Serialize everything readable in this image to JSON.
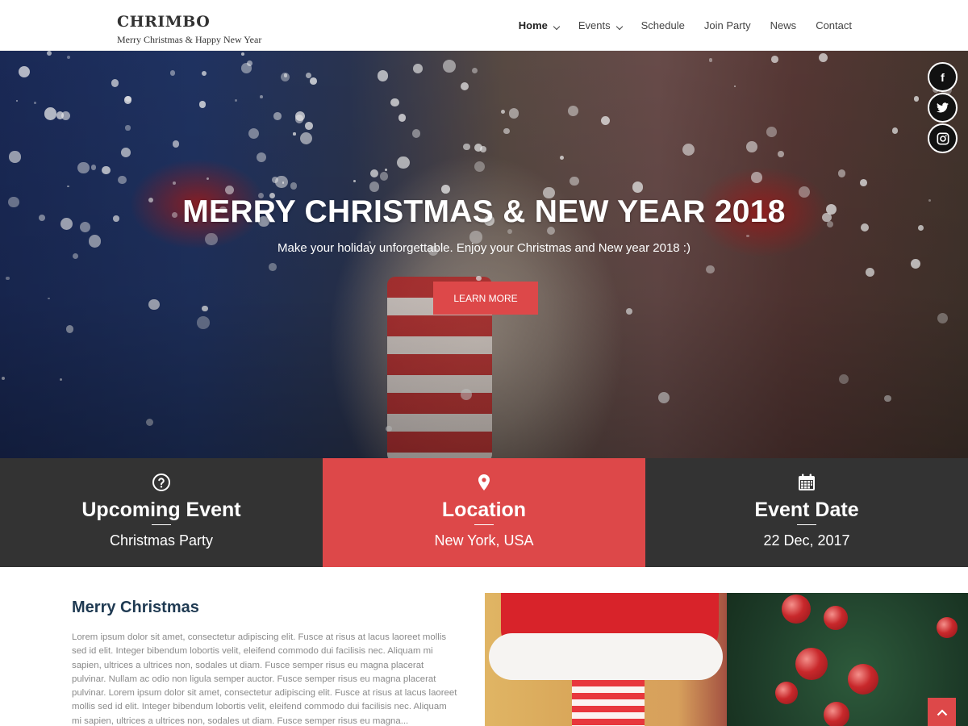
{
  "brand": {
    "title": "CHRIMBO",
    "tagline": "Merry Christmas & Happy New Year"
  },
  "nav": {
    "items": [
      {
        "label": "Home",
        "dropdown": true,
        "active": true
      },
      {
        "label": "Events",
        "dropdown": true
      },
      {
        "label": "Schedule"
      },
      {
        "label": "Join Party"
      },
      {
        "label": "News"
      },
      {
        "label": "Contact"
      }
    ]
  },
  "hero": {
    "title": "MERRY CHRISTMAS & NEW YEAR 2018",
    "subtitle": "Make your holiday unforgettable. Enjoy your Christmas and New year 2018 :)",
    "button_label": "LEARN MORE"
  },
  "social": {
    "facebook_glyph": "f",
    "twitter_glyph": "t"
  },
  "info": [
    {
      "icon": "question-circle-icon",
      "title": "Upcoming Event",
      "value": "Christmas Party"
    },
    {
      "icon": "map-marker-icon",
      "title": "Location",
      "value": "New York, USA"
    },
    {
      "icon": "calendar-icon",
      "title": "Event Date",
      "value": "22 Dec, 2017"
    }
  ],
  "article": {
    "title": "Merry Christmas",
    "body": "Lorem ipsum dolor sit amet, consectetur adipiscing elit. Fusce at risus at lacus laoreet mollis sed id elit. Integer bibendum lobortis velit, eleifend commodo dui facilisis nec. Aliquam mi sapien, ultrices a ultrices non, sodales ut diam. Fusce semper risus eu magna placerat pulvinar. Nullam ac odio non ligula semper auctor. Fusce semper risus eu magna placerat pulvinar. Lorem ipsum dolor sit amet, consectetur adipiscing elit. Fusce at risus at lacus laoreet mollis sed id elit. Integer bibendum lobortis velit, eleifend commodo dui facilisis nec. Aliquam mi sapien, ultrices a ultrices non, sodales ut diam. Fusce semper risus eu magna..."
  },
  "colors": {
    "accent": "#dd4849",
    "dark_panel": "#333333",
    "heading": "#1f3a52",
    "body_text": "#8a8a8a"
  }
}
